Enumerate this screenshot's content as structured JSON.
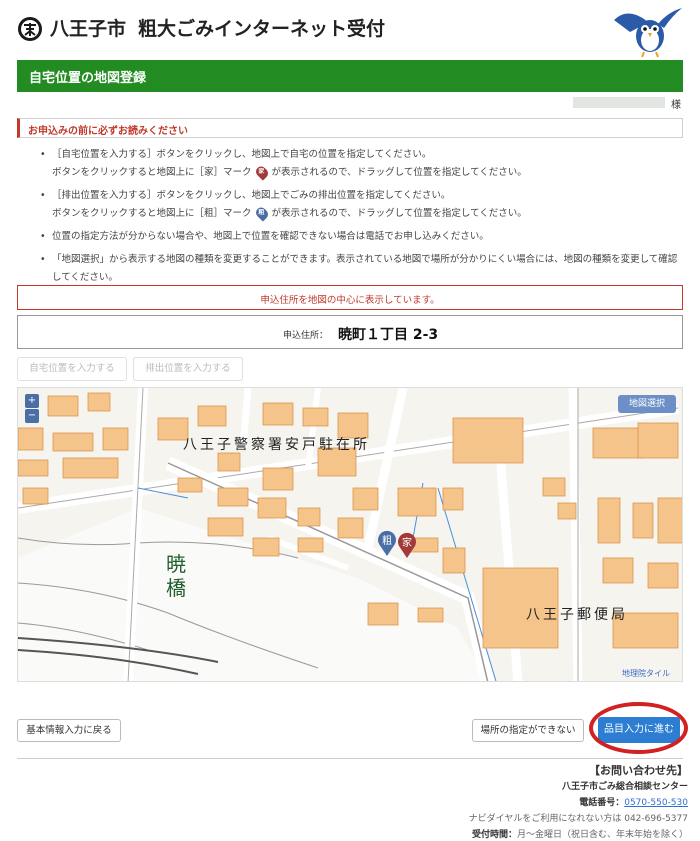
{
  "header": {
    "title_city": "八王子市",
    "title_service": "粗大ごみインターネット受付"
  },
  "page_title": "自宅位置の地図登録",
  "user": {
    "honorific": "様"
  },
  "notice_heading": "お申込みの前に必ずお読みください",
  "instructions": [
    {
      "before": "［自宅位置を入力する］ボタンをクリックし、地図上で自宅の位置を指定してください。",
      "line2_before": "ボタンをクリックすると地図上に［家］マーク",
      "marker": "家",
      "line2_after": "が表示されるので、ドラッグして位置を指定してください。"
    },
    {
      "before": "［排出位置を入力する］ボタンをクリックし、地図上でごみの排出位置を指定してください。",
      "line2_before": "ボタンをクリックすると地図上に［粗］マーク",
      "marker": "粗",
      "line2_after": "が表示されるので、ドラッグして位置を指定してください。"
    },
    {
      "text": "位置の指定方法が分からない場合や、地図上で位置を確認できない場合は電話でお申し込みください。"
    },
    {
      "text": "「地図選択」から表示する地図の種類を変更することができます。表示されている地図で場所が分かりにくい場合には、地図の種類を変更して確認してください。"
    }
  ],
  "alert": "申込住所を地図の中心に表示しています。",
  "address": {
    "label": "申込住所：",
    "value": "暁町１丁目 2-3"
  },
  "buttons": {
    "set_home": "自宅位置を入力する",
    "set_disposal": "排出位置を入力する",
    "back": "基本情報入力に戻る",
    "cannot_specify": "場所の指定ができない",
    "next": "品目入力に進む"
  },
  "map": {
    "zoom_in": "+",
    "zoom_out": "−",
    "select": "地図選択",
    "credit": "地理院タイル",
    "label_police": "八王子警察署安戸駐在所",
    "label_post": "八王子郵便局",
    "label_bridge": "暁橋",
    "marker_home": "家",
    "marker_disposal": "粗"
  },
  "contact": {
    "heading": "【お問い合わせ先】",
    "center": "八王子市ごみ総合相談センター",
    "phone_label": "電話番号：",
    "phone": "0570-550-530",
    "navi_note": "ナビダイヤルをご利用になれない方は",
    "alt_phone": "042-696-5377",
    "hours_label": "受付時間：",
    "hours": "月～金曜日（祝日含む、年末年始を除く）"
  },
  "colors": {
    "green": "#228b22",
    "red": "#c0392b",
    "blue": "#2d7dd2",
    "pin_home": "#a23a3a",
    "pin_disposal": "#4a6fa5"
  }
}
